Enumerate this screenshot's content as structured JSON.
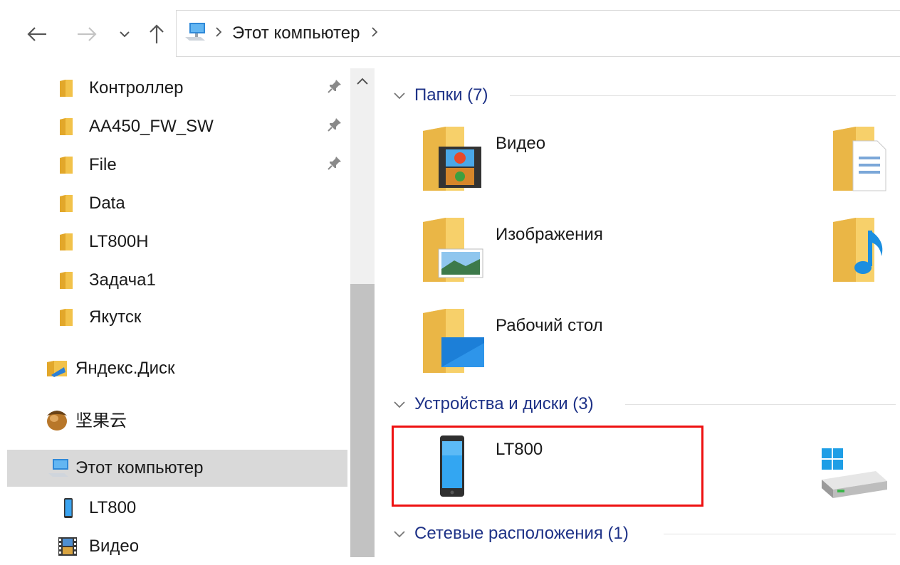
{
  "nav": {
    "back_icon": "arrow-left-icon",
    "forward_icon": "arrow-right-icon",
    "recent_icon": "chevron-down-icon",
    "up_icon": "arrow-up-icon"
  },
  "address": {
    "icon": "computer-icon",
    "crumb": "Этот компьютер"
  },
  "sidebar": {
    "quick_access": [
      {
        "label": "Контроллер",
        "pinned": true
      },
      {
        "label": "AA450_FW_SW",
        "pinned": true
      },
      {
        "label": "File",
        "pinned": true
      },
      {
        "label": "Data",
        "pinned": false
      },
      {
        "label": "LT800H",
        "pinned": false
      },
      {
        "label": "Задача1",
        "pinned": false
      },
      {
        "label": "Якутск",
        "pinned": false
      }
    ],
    "yandex": "Яндекс.Диск",
    "jianguoyun": "坚果云",
    "this_pc": "Этот компьютер",
    "lt800": "LT800",
    "video": "Видео"
  },
  "content": {
    "groups": {
      "folders": "Папки (7)",
      "devices": "Устройства и диски (3)",
      "network": "Сетевые расположения (1)"
    },
    "folders": [
      {
        "label": "Видео",
        "icon": "video-folder-icon"
      },
      {
        "label": "Изображения",
        "icon": "pictures-folder-icon"
      },
      {
        "label": "Рабочий стол",
        "icon": "desktop-folder-icon"
      }
    ],
    "devices": [
      {
        "label": "LT800",
        "icon": "phone-device-icon"
      }
    ]
  },
  "colors": {
    "group_heading": "#1e3287",
    "selection": "#d9d9d9",
    "highlight_box": "#ee1111"
  }
}
